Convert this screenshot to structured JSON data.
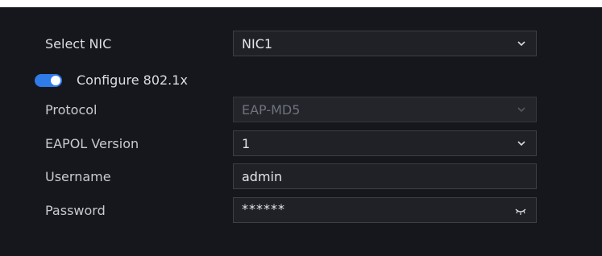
{
  "form": {
    "select_nic": {
      "label": "Select NIC",
      "value": "NIC1"
    },
    "configure_8021x": {
      "label": "Configure 802.1x",
      "enabled": true
    },
    "protocol": {
      "label": "Protocol",
      "value": "EAP-MD5",
      "disabled": true
    },
    "eapol_version": {
      "label": "EAPOL Version",
      "value": "1"
    },
    "username": {
      "label": "Username",
      "value": "admin"
    },
    "password": {
      "label": "Password",
      "value": "******"
    }
  },
  "colors": {
    "background": "#16171c",
    "field_bg": "#1f2127",
    "field_border": "#3c3f48",
    "toggle_on": "#2f7be8"
  },
  "icons": {
    "dropdown": "chevron-down-icon",
    "password_toggle": "eye-closed-icon"
  }
}
